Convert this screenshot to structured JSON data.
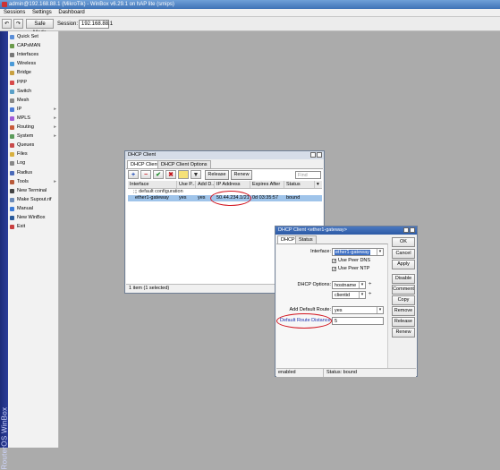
{
  "window": {
    "title": "admin@192.168.88.1 (MikroTik) - WinBox v6.29.1 on hAP lite (smips)"
  },
  "menu": [
    "Sessions",
    "Settings",
    "Dashboard"
  ],
  "toolbar": {
    "safe_mode": "Safe Mode",
    "session_label": "Session:",
    "session_value": "192.168.88.1"
  },
  "brand": "RouterOS WinBox",
  "sidebar": [
    {
      "label": "Quick Set",
      "arrow": ""
    },
    {
      "label": "CAPsMAN",
      "arrow": ""
    },
    {
      "label": "Interfaces",
      "arrow": ""
    },
    {
      "label": "Wireless",
      "arrow": ""
    },
    {
      "label": "Bridge",
      "arrow": ""
    },
    {
      "label": "PPP",
      "arrow": ""
    },
    {
      "label": "Switch",
      "arrow": ""
    },
    {
      "label": "Mesh",
      "arrow": ""
    },
    {
      "label": "IP",
      "arrow": "▸"
    },
    {
      "label": "MPLS",
      "arrow": "▸"
    },
    {
      "label": "Routing",
      "arrow": "▸"
    },
    {
      "label": "System",
      "arrow": "▸"
    },
    {
      "label": "Queues",
      "arrow": ""
    },
    {
      "label": "Files",
      "arrow": ""
    },
    {
      "label": "Log",
      "arrow": ""
    },
    {
      "label": "Radius",
      "arrow": ""
    },
    {
      "label": "Tools",
      "arrow": "▸"
    },
    {
      "label": "New Terminal",
      "arrow": ""
    },
    {
      "label": "Make Supout.rif",
      "arrow": ""
    },
    {
      "label": "Manual",
      "arrow": ""
    },
    {
      "label": "New WinBox",
      "arrow": ""
    },
    {
      "label": "Exit",
      "arrow": ""
    }
  ],
  "dhcp_client": {
    "title": "DHCP Client",
    "tabs": [
      "DHCP Client",
      "DHCP Client Options"
    ],
    "release": "Release",
    "renew": "Renew",
    "find_placeholder": "Find",
    "columns": [
      "Interface",
      "Use P...",
      "Add D...",
      "IP Address",
      "Expires After",
      "Status"
    ],
    "comment": ";;; default configuration",
    "row": {
      "interface": "ether1-gateway",
      "use_peer": "yes",
      "add_default": "yes",
      "ip": "50.44.234.1/21",
      "expires": "0d 03:35:57",
      "status": "bound"
    },
    "status": "1 item (1 selected)"
  },
  "dialog": {
    "title": "DHCP Client <ether1-gateway>",
    "tabs": [
      "DHCP",
      "Status"
    ],
    "interface_label": "Interface:",
    "interface_value": "ether1-gateway",
    "use_peer_dns": "Use Peer DNS",
    "use_peer_ntp": "Use Peer NTP",
    "options_label": "DHCP Options:",
    "option1": "hostname",
    "option2": "clientid",
    "add_default_label": "Add Default Route:",
    "add_default_value": "yes",
    "distance_label": "Default Route Distance:",
    "distance_value": "5",
    "buttons": [
      "OK",
      "Cancel",
      "Apply",
      "Disable",
      "Comment",
      "Copy",
      "Remove",
      "Release",
      "Renew"
    ],
    "status_left": "enabled",
    "status_right": "Status: bound"
  },
  "colors": {
    "accent_blue": "#3f73b6",
    "highlight_red": "#d2141e",
    "selection": "#9fc4ea"
  }
}
